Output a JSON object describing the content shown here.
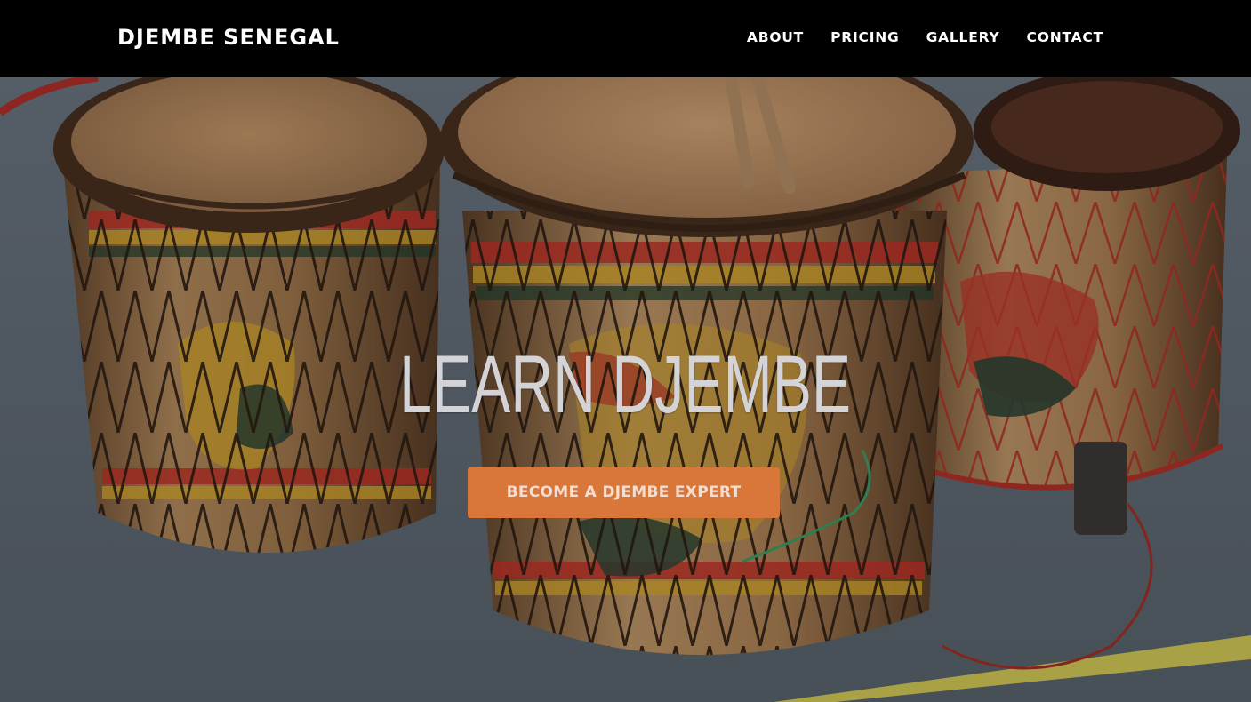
{
  "header": {
    "brand": "DJEMBE SENEGAL",
    "nav": {
      "about": "ABOUT",
      "pricing": "PRICING",
      "gallery": "GALLERY",
      "contact": "CONTACT"
    }
  },
  "hero": {
    "title": "LEARN DJEMBE",
    "cta_label": "BECOME A DJEMBE EXPERT",
    "background_image": "djembe-drums-photo"
  },
  "colors": {
    "header_bg": "#000000",
    "cta_bg": "#d9763a",
    "hero_title": "#d4d4d8",
    "nav_text": "#ffffff"
  }
}
